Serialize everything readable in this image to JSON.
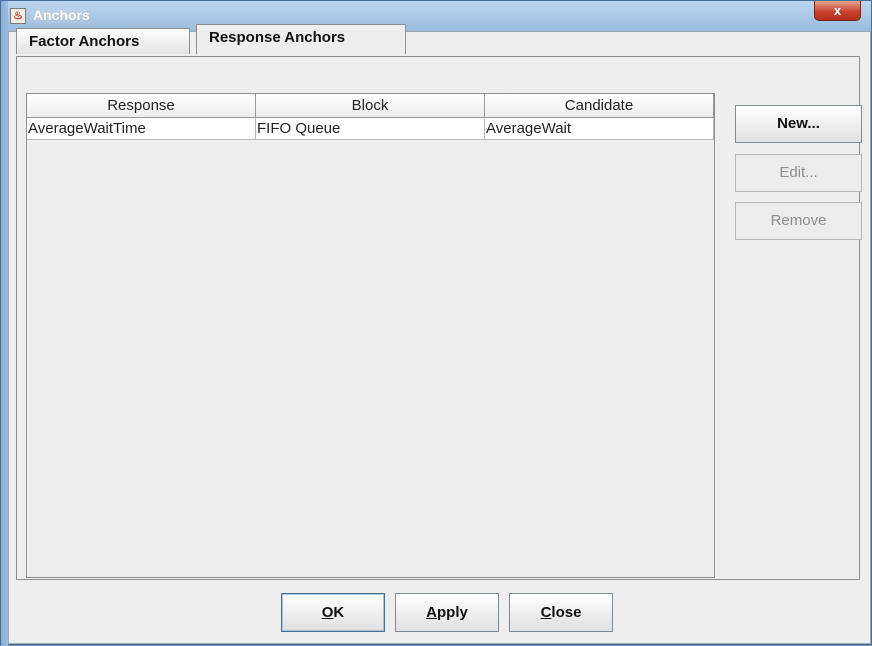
{
  "window": {
    "title": "Anchors",
    "close_glyph": "x"
  },
  "tabs": [
    {
      "label": "Factor Anchors",
      "selected": false
    },
    {
      "label": "Response Anchors",
      "selected": true
    }
  ],
  "table": {
    "columns": [
      "Response",
      "Block",
      "Candidate"
    ],
    "rows": [
      [
        "AverageWaitTime",
        "FIFO Queue",
        "AverageWait"
      ]
    ]
  },
  "side_buttons": {
    "new_label": "New...",
    "edit_label": "Edit...",
    "remove_label": "Remove"
  },
  "bottom_buttons": {
    "ok": {
      "mnemonic": "O",
      "rest": "K"
    },
    "apply": {
      "mnemonic": "A",
      "rest": "pply"
    },
    "close": {
      "mnemonic": "C",
      "rest": "lose"
    }
  },
  "colors": {
    "title_bar": "#8fb2d6",
    "close_button": "#c9432d",
    "dialog_bg": "#eeeeee"
  }
}
